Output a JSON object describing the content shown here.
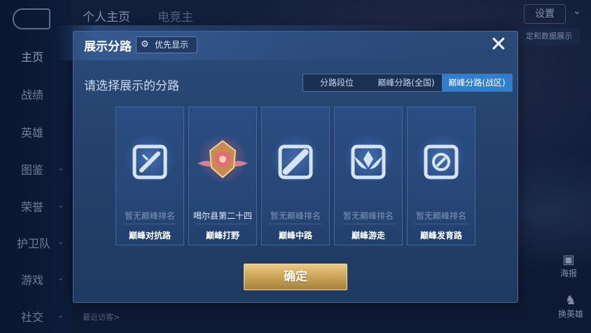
{
  "background": {
    "nav_items": [
      {
        "label": "主页",
        "active": true
      },
      {
        "label": "战绩",
        "active": false
      },
      {
        "label": "英雄",
        "active": false
      },
      {
        "label": "图鉴",
        "active": false
      },
      {
        "label": "荣誉",
        "active": false
      },
      {
        "label": "护卫队",
        "active": false
      },
      {
        "label": "游戏",
        "active": false
      },
      {
        "label": "社交",
        "active": false
      }
    ],
    "top_tab_1": "个人主页",
    "top_tab_2": "电竞主",
    "settings_label": "设置",
    "data_display_label": "定和数据展示",
    "recent_visitors": "最近访客>",
    "poster_label": "海报",
    "rankup_label": "换英雄"
  },
  "dialog": {
    "title": "展示分路",
    "priority_button": "优先显示",
    "subtitle": "请选择展示的分路",
    "tabs": [
      {
        "label": "分路段位",
        "selected": false
      },
      {
        "label": "巅峰分路(全国)",
        "selected": false
      },
      {
        "label": "巅峰分路(战区)",
        "selected": true
      }
    ],
    "lanes": [
      {
        "rank": "暂无巅峰排名",
        "name": "巅峰对抗路",
        "icon": "clash-lane-icon",
        "lit": false
      },
      {
        "rank": "喝尔县第二十四",
        "name": "巅峰打野",
        "icon": "jungle-badge-icon",
        "lit": true
      },
      {
        "rank": "暂无巅峰排名",
        "name": "巅峰中路",
        "icon": "mid-lane-icon",
        "lit": false
      },
      {
        "rank": "暂无巅峰排名",
        "name": "巅峰游走",
        "icon": "roam-icon",
        "lit": false
      },
      {
        "rank": "暂无巅峰排名",
        "name": "巅峰发育路",
        "icon": "farm-lane-icon",
        "lit": false
      }
    ],
    "confirm": "确定"
  },
  "colors": {
    "accent_blue": "#2f7fd0",
    "confirm_gold": "#c8a055"
  }
}
